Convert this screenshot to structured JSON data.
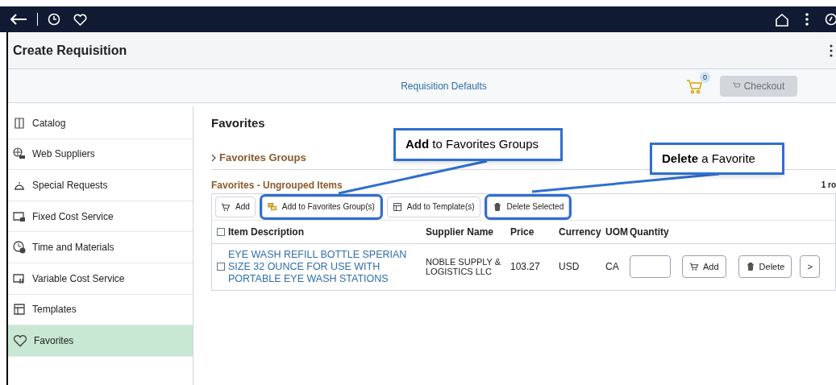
{
  "page_title": "Create Requisition",
  "toolbar": {
    "link": "Requisition Defaults",
    "cart_count": "0",
    "checkout": {
      "label": "Checkout",
      "disabled": true
    }
  },
  "sidebar": {
    "items": [
      {
        "label": "Catalog",
        "kind": "book",
        "selected": false
      },
      {
        "label": "Web Suppliers",
        "kind": "globe",
        "selected": false
      },
      {
        "label": "Special Requests",
        "kind": "bell",
        "selected": false
      },
      {
        "label": "Fixed Cost Service",
        "kind": "fixed",
        "selected": false
      },
      {
        "label": "Time and Materials",
        "kind": "clock",
        "selected": false
      },
      {
        "label": "Variable Cost Service",
        "kind": "variable",
        "selected": false
      },
      {
        "label": "Templates",
        "kind": "layout",
        "selected": false
      },
      {
        "label": "Favorites",
        "kind": "heart",
        "selected": true
      }
    ]
  },
  "main": {
    "heading": "Favorites",
    "groups_link": "Favorites Groups",
    "section_title": "Favorites - Ungrouped Items",
    "row_count": "1 ro",
    "actions": [
      {
        "label": "Add",
        "kind": "cart",
        "highlighted": false
      },
      {
        "label": "Add to Favorites Group(s)",
        "kind": "group",
        "highlighted": true
      },
      {
        "label": "Add to Template(s)",
        "kind": "layout",
        "highlighted": false
      },
      {
        "label": "Delete Selected",
        "kind": "trash",
        "highlighted": true
      }
    ],
    "table": {
      "select_all_checked": false,
      "columns": [
        "Item Description",
        "Supplier Name",
        "Price",
        "Currency",
        "UOM",
        "Quantity"
      ],
      "rows": [
        {
          "checked": false,
          "description": "EYE WASH REFILL BOTTLE SPERIAN SIZE 32 OUNCE FOR USE WITH PORTABLE EYE WASH STATIONS",
          "supplier": "NOBLE SUPPLY & LOGISTICS LLC",
          "price": "103.27",
          "currency": "USD",
          "uom": "CA",
          "add": "Add",
          "delete": "Delete",
          "more": ">"
        }
      ]
    }
  },
  "callouts": [
    {
      "text": "**Add** to Favorites Groups"
    },
    {
      "text": "**Delete** a Favorite"
    }
  ]
}
